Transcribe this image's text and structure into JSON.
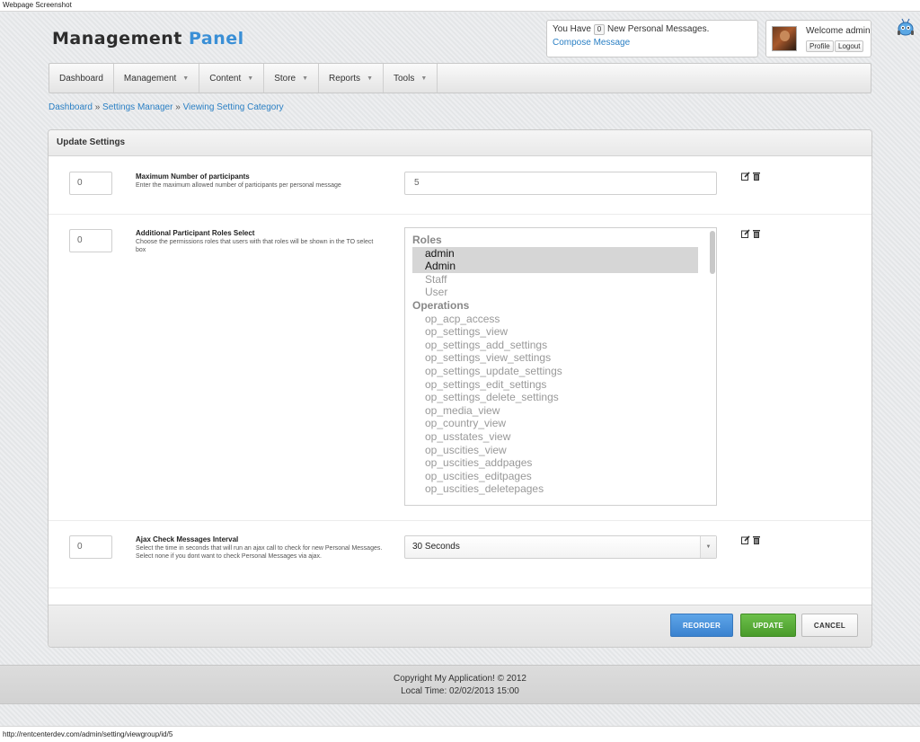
{
  "window_title": "Webpage Screenshot",
  "logo": {
    "part1": "Management",
    "part2": "Panel"
  },
  "messages": {
    "prefix": "You Have",
    "count": "0",
    "suffix": "New Personal Messages.",
    "compose_label": "Compose Message"
  },
  "user": {
    "welcome": "Welcome admin",
    "profile_label": "Profile",
    "logout_label": "Logout"
  },
  "nav": [
    {
      "label": "Dashboard",
      "has_caret": false
    },
    {
      "label": "Management",
      "has_caret": true
    },
    {
      "label": "Content",
      "has_caret": true
    },
    {
      "label": "Store",
      "has_caret": true
    },
    {
      "label": "Reports",
      "has_caret": true
    },
    {
      "label": "Tools",
      "has_caret": true
    }
  ],
  "breadcrumb": {
    "items": [
      "Dashboard",
      "Settings Manager",
      "Viewing Setting Category"
    ],
    "separator": "»"
  },
  "panel": {
    "title": "Update Settings"
  },
  "settings": [
    {
      "order": "0",
      "title": "Maximum Number of participants",
      "description": "Enter the maximum allowed number of participants per personal message",
      "value": "5"
    },
    {
      "order": "0",
      "title": "Additional Participant Roles Select",
      "description": "Choose the permissions roles that users with that roles will be shown in the TO select box",
      "groups": [
        {
          "label": "Roles",
          "options": [
            {
              "label": "admin",
              "selected": true
            },
            {
              "label": "Admin",
              "selected": true
            },
            {
              "label": "Staff",
              "selected": false
            },
            {
              "label": "User",
              "selected": false
            }
          ]
        },
        {
          "label": "Operations",
          "options": [
            {
              "label": "op_acp_access",
              "selected": false
            },
            {
              "label": "op_settings_view",
              "selected": false
            },
            {
              "label": "op_settings_add_settings",
              "selected": false
            },
            {
              "label": "op_settings_view_settings",
              "selected": false
            },
            {
              "label": "op_settings_update_settings",
              "selected": false
            },
            {
              "label": "op_settings_edit_settings",
              "selected": false
            },
            {
              "label": "op_settings_delete_settings",
              "selected": false
            },
            {
              "label": "op_media_view",
              "selected": false
            },
            {
              "label": "op_country_view",
              "selected": false
            },
            {
              "label": "op_usstates_view",
              "selected": false
            },
            {
              "label": "op_uscities_view",
              "selected": false
            },
            {
              "label": "op_uscities_addpages",
              "selected": false
            },
            {
              "label": "op_uscities_editpages",
              "selected": false
            },
            {
              "label": "op_uscities_deletepages",
              "selected": false
            }
          ]
        }
      ]
    },
    {
      "order": "0",
      "title": "Ajax Check Messages Interval",
      "description": "Select the time in seconds that will run an ajax call to check for new Personal Messages. Select none if you dont want to check Personal Messages via ajax.",
      "selected": "30 Seconds"
    }
  ],
  "buttons": {
    "reorder": "REORDER",
    "update": "UPDATE",
    "cancel": "CANCEL"
  },
  "footer": {
    "copyright": "Copyright My Application! © 2012",
    "local_time": "Local Time: 02/02/2013 15:00"
  },
  "status_url": "http://rentcenterdev.com/admin/setting/viewgroup/id/5",
  "colors": {
    "accent_blue": "#3a8fd6",
    "update_green": "#4a9b2b",
    "reorder_blue": "#3a82cf"
  }
}
